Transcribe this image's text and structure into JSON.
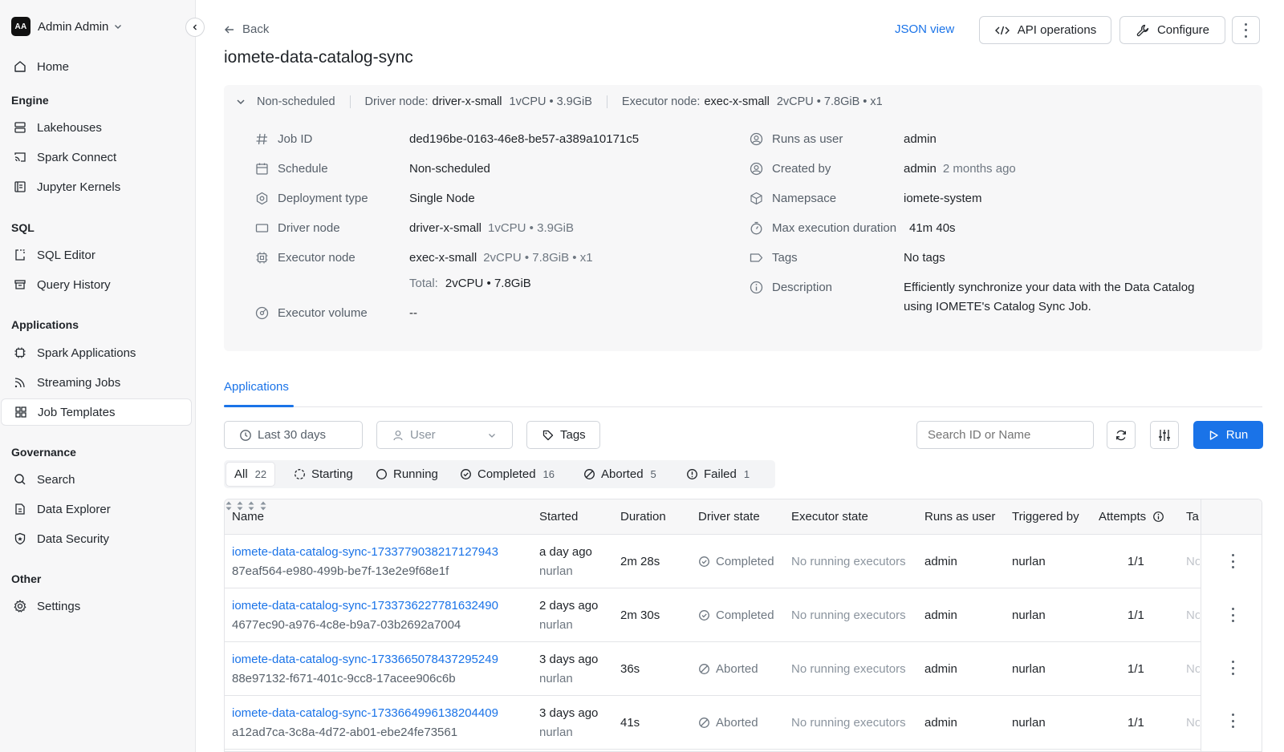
{
  "sidebar": {
    "user": {
      "initials": "AA",
      "name": "Admin Admin"
    },
    "home": "Home",
    "sections": {
      "engine": "Engine",
      "sql": "SQL",
      "applications": "Applications",
      "governance": "Governance",
      "other": "Other"
    },
    "items": {
      "lakehouses": "Lakehouses",
      "spark_connect": "Spark Connect",
      "jupyter_kernels": "Jupyter Kernels",
      "sql_editor": "SQL Editor",
      "query_history": "Query History",
      "spark_applications": "Spark Applications",
      "streaming_jobs": "Streaming Jobs",
      "job_templates": "Job Templates",
      "search": "Search",
      "data_explorer": "Data Explorer",
      "data_security": "Data Security",
      "settings": "Settings"
    },
    "active_item": "job_templates"
  },
  "header": {
    "back": "Back",
    "title": "iomete-data-catalog-sync",
    "json_view": "JSON view",
    "api_operations": "API operations",
    "configure": "Configure"
  },
  "summary": {
    "schedule": "Non-scheduled",
    "driver_label": "Driver node:",
    "driver_value": "driver-x-small",
    "driver_spec": "1vCPU • 3.9GiB",
    "executor_label": "Executor node:",
    "executor_value": "exec-x-small",
    "executor_spec": "2vCPU • 7.8GiB • x1"
  },
  "details": {
    "left": {
      "job_id": {
        "label": "Job ID",
        "value": "ded196be-0163-46e8-be57-a389a10171c5"
      },
      "schedule": {
        "label": "Schedule",
        "value": "Non-scheduled"
      },
      "deployment_type": {
        "label": "Deployment type",
        "value": "Single Node"
      },
      "driver_node": {
        "label": "Driver node",
        "value": "driver-x-small",
        "spec": "1vCPU • 3.9GiB"
      },
      "executor_node": {
        "label": "Executor node",
        "value": "exec-x-small",
        "spec": "2vCPU • 7.8GiB • x1"
      },
      "total": {
        "label": "Total:",
        "value": "2vCPU • 7.8GiB"
      },
      "executor_volume": {
        "label": "Executor volume",
        "value": "--"
      }
    },
    "right": {
      "runs_as_user": {
        "label": "Runs as user",
        "value": "admin"
      },
      "created_by": {
        "label": "Created by",
        "value": "admin",
        "when": "2 months ago"
      },
      "namespace": {
        "label": "Namepsace",
        "value": "iomete-system"
      },
      "max_execution": {
        "label": "Max execution duration",
        "value": "41m 40s"
      },
      "tags": {
        "label": "Tags",
        "value": "No tags"
      },
      "description": {
        "label": "Description",
        "line1": "Efficiently synchronize your data with the Data Catalog",
        "line2": "using IOMETE's Catalog Sync Job."
      }
    }
  },
  "tabs": {
    "applications": "Applications"
  },
  "filters": {
    "date": "Last 30 days",
    "user_placeholder": "User",
    "tags": "Tags",
    "search_placeholder": "Search ID or Name",
    "run": "Run"
  },
  "status_filters": [
    {
      "label": "All",
      "count": "22"
    },
    {
      "label": "Starting",
      "count": ""
    },
    {
      "label": "Running",
      "count": ""
    },
    {
      "label": "Completed",
      "count": "16"
    },
    {
      "label": "Aborted",
      "count": "5"
    },
    {
      "label": "Failed",
      "count": "1"
    }
  ],
  "table": {
    "columns": {
      "name": "Name",
      "started": "Started",
      "duration": "Duration",
      "driver_state": "Driver state",
      "executor_state": "Executor state",
      "runs_as_user": "Runs as user",
      "triggered_by": "Triggered by",
      "attempts": "Attempts",
      "tags": "Ta"
    },
    "rows": [
      {
        "name": "iomete-data-catalog-sync-1733779038217127943",
        "id": "87eaf564-e980-499b-be7f-13e2e9f68e1f",
        "started": "a day ago",
        "started_by": "nurlan",
        "duration": "2m 28s",
        "driver_state": "Completed",
        "executor_state": "No running executors",
        "user": "admin",
        "triggered_by": "nurlan",
        "attempts": "1/1",
        "tags": "No"
      },
      {
        "name": "iomete-data-catalog-sync-1733736227781632490",
        "id": "4677ec90-a976-4c8e-b9a7-03b2692a7004",
        "started": "2 days ago",
        "started_by": "nurlan",
        "duration": "2m 30s",
        "driver_state": "Completed",
        "executor_state": "No running executors",
        "user": "admin",
        "triggered_by": "nurlan",
        "attempts": "1/1",
        "tags": "No"
      },
      {
        "name": "iomete-data-catalog-sync-1733665078437295249",
        "id": "88e97132-f671-401c-9cc8-17acee906c6b",
        "started": "3 days ago",
        "started_by": "nurlan",
        "duration": "36s",
        "driver_state": "Aborted",
        "executor_state": "No running executors",
        "user": "admin",
        "triggered_by": "nurlan",
        "attempts": "1/1",
        "tags": "No"
      },
      {
        "name": "iomete-data-catalog-sync-1733664996138204409",
        "id": "a12ad7ca-3c8a-4d72-ab01-ebe24fe73561",
        "started": "3 days ago",
        "started_by": "nurlan",
        "duration": "41s",
        "driver_state": "Aborted",
        "executor_state": "No running executors",
        "user": "admin",
        "triggered_by": "nurlan",
        "attempts": "1/1",
        "tags": "No"
      }
    ]
  },
  "colors": {
    "accent": "#1a73e8",
    "sidebar_bg": "#f7f7f8",
    "panel_bg": "#f7f7f8"
  },
  "icons": {
    "home": "home-icon",
    "lakehouses": "server-icon",
    "spark_connect": "cast-icon",
    "jupyter_kernels": "notebook-icon",
    "sql_editor": "editor-icon",
    "query_history": "archive-icon",
    "spark_applications": "chip-icon",
    "streaming_jobs": "rss-icon",
    "job_templates": "grid-icon",
    "search": "search-icon",
    "data_explorer": "document-icon",
    "data_security": "shield-icon",
    "settings": "gear-icon"
  }
}
